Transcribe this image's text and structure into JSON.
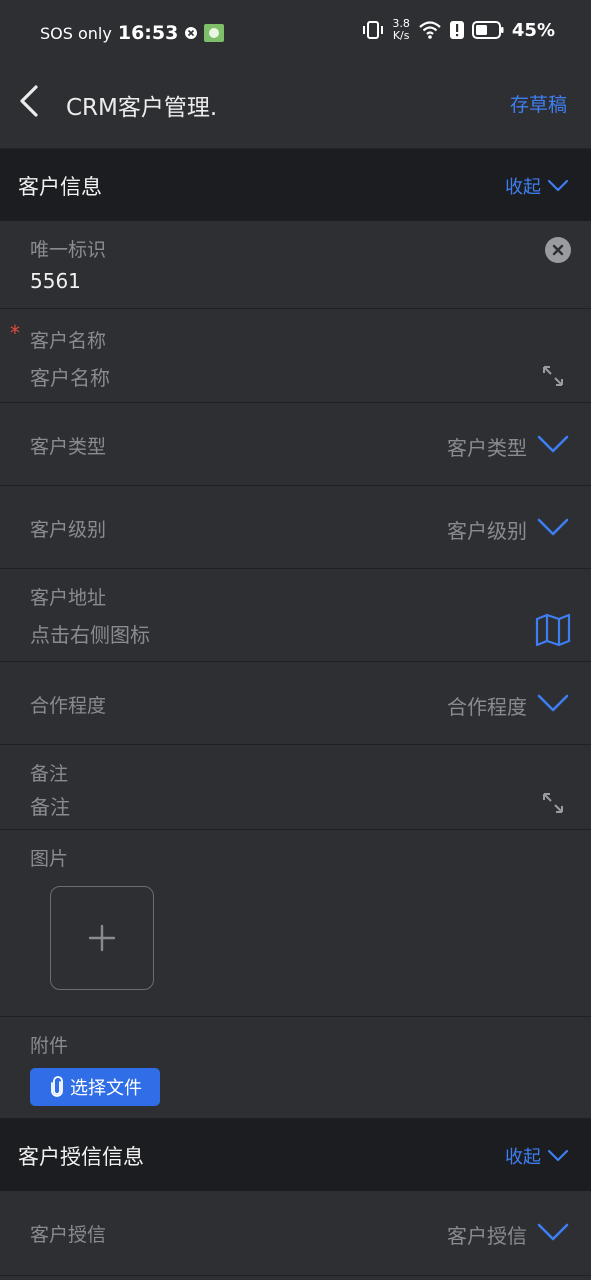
{
  "status_bar": {
    "carrier": "SOS only",
    "time": "16:53",
    "net_speed_value": "3.8",
    "net_speed_unit": "K/s",
    "battery": "45%"
  },
  "app_bar": {
    "title": "CRM客户管理.",
    "save_draft": "存草稿"
  },
  "section1": {
    "title": "客户信息",
    "toggle": "收起",
    "fields": {
      "unique_id": {
        "label": "唯一标识",
        "value": "5561"
      },
      "name": {
        "required_mark": "*",
        "label": "客户名称",
        "placeholder": "客户名称"
      },
      "type": {
        "label": "客户类型",
        "placeholder": "客户类型"
      },
      "level": {
        "label": "客户级别",
        "placeholder": "客户级别"
      },
      "address": {
        "label": "客户地址",
        "placeholder": "点击右侧图标"
      },
      "cooperation": {
        "label": "合作程度",
        "placeholder": "合作程度"
      },
      "remark": {
        "label": "备注",
        "placeholder": "备注"
      },
      "image": {
        "label": "图片",
        "add_symbol": "+"
      },
      "attachment": {
        "label": "附件",
        "button": "选择文件"
      }
    }
  },
  "section2": {
    "title": "客户授信信息",
    "toggle": "收起",
    "fields": {
      "credit": {
        "label": "客户授信",
        "placeholder": "客户授信"
      }
    }
  },
  "colors": {
    "accent": "#3d7ef2",
    "button": "#2f6ee6",
    "required": "#e64a3b",
    "background": "#2e2f33",
    "section_header": "#1c1d20"
  },
  "icons": [
    "back-arrow-icon",
    "close-icon",
    "expand-icon",
    "chevron-down-icon",
    "map-icon",
    "plus-icon",
    "paperclip-icon",
    "vibrate-icon",
    "wifi-icon",
    "battery-icon"
  ]
}
